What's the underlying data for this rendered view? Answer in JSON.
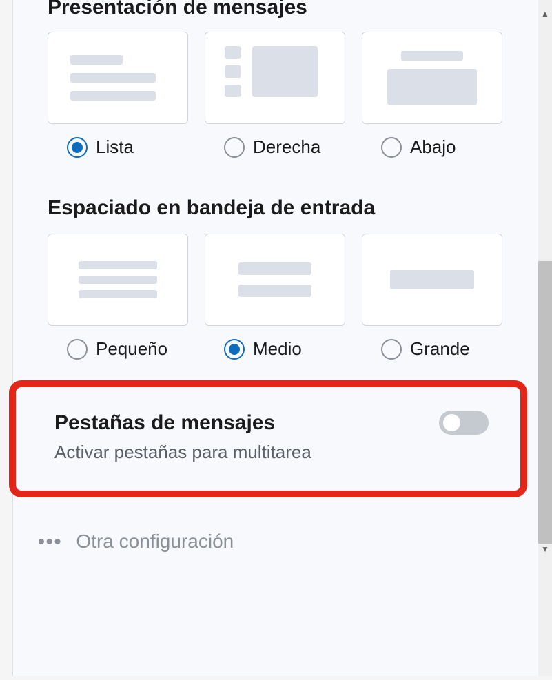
{
  "sections": {
    "presentation": {
      "title": "Presentación de mensajes",
      "options": [
        {
          "id": "lista",
          "label": "Lista",
          "selected": true
        },
        {
          "id": "derecha",
          "label": "Derecha",
          "selected": false
        },
        {
          "id": "abajo",
          "label": "Abajo",
          "selected": false
        }
      ]
    },
    "spacing": {
      "title": "Espaciado en bandeja de entrada",
      "options": [
        {
          "id": "pequeno",
          "label": "Pequeño",
          "selected": false
        },
        {
          "id": "medio",
          "label": "Medio",
          "selected": true
        },
        {
          "id": "grande",
          "label": "Grande",
          "selected": false
        }
      ]
    },
    "tabs": {
      "title": "Pestañas de mensajes",
      "subtitle": "Activar pestañas para multitarea",
      "enabled": false
    },
    "other": {
      "label": "Otra configuración"
    }
  }
}
